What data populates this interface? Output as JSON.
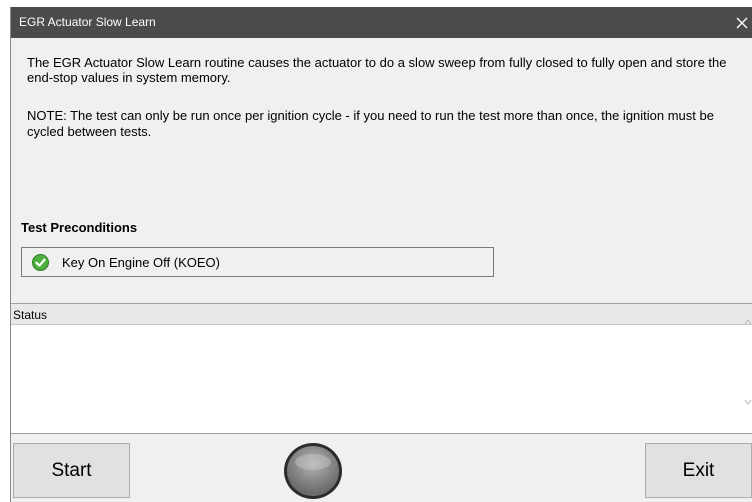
{
  "window": {
    "title": "EGR Actuator Slow Learn",
    "close_glyph": "✕"
  },
  "description": {
    "intro": "The EGR Actuator Slow Learn routine causes the actuator to do a slow sweep from fully closed to fully open and store the end-stop values in system memory.",
    "note": "NOTE: The test can only be run once per ignition cycle - if you need to run the test more than once, the ignition must be cycled between tests."
  },
  "preconditions": {
    "heading": "Test Preconditions",
    "items": [
      {
        "label": "Key On Engine Off (KOEO)",
        "icon": "check-icon",
        "met": true
      }
    ]
  },
  "status": {
    "header": "Status",
    "text": ""
  },
  "buttons": {
    "start": "Start",
    "exit": "Exit"
  },
  "indicator": {
    "icon": "status-led-icon",
    "color": "#8a8a8a"
  },
  "colors": {
    "titlebar": "#4b4b4b",
    "check": "#4caf3e"
  }
}
